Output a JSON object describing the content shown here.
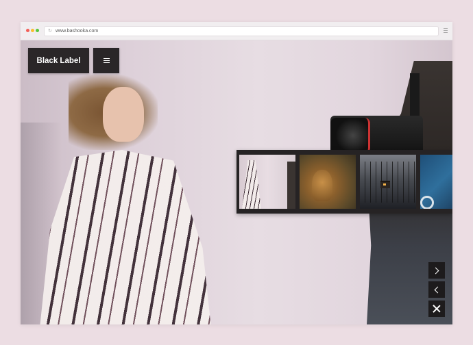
{
  "browser": {
    "url": "www.bashooka.com"
  },
  "header": {
    "brand_label": "Black Label"
  },
  "icons": {
    "menu": "hamburger-icon",
    "reload": "reload-icon",
    "next": "chevron-right-icon",
    "prev": "chevron-left-icon",
    "close": "close-icon"
  },
  "colors": {
    "background": "#ecdde3",
    "button_dark": "#2a2628",
    "strip_dark": "#262324"
  }
}
